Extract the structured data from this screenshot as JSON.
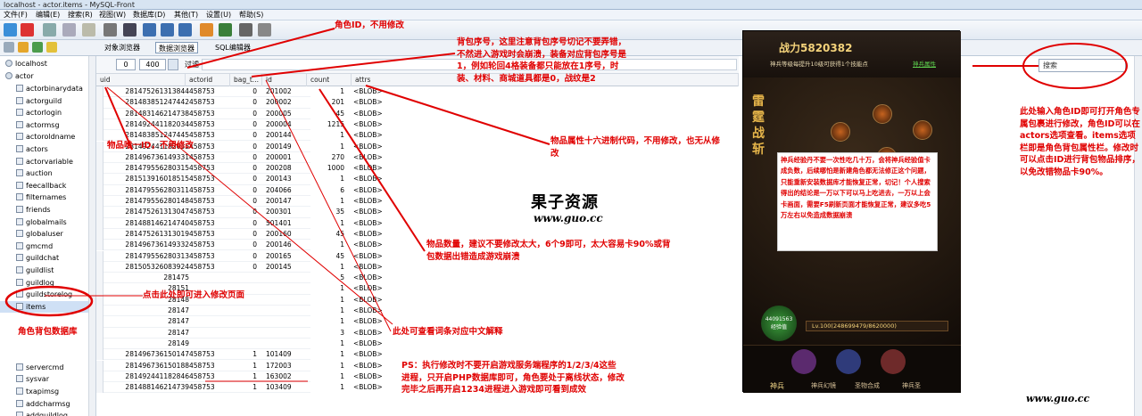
{
  "window": {
    "title": "localhost - actor.items - MySQL-Front"
  },
  "menu": [
    "文件(F)",
    "编辑(E)",
    "搜索(R)",
    "视图(W)",
    "数据库(D)",
    "其他(T)",
    "设置(U)",
    "帮助(S)"
  ],
  "tabs": {
    "object_browser": "对象浏览器",
    "data_browser": "数据浏览器",
    "sql_editor": "SQL编辑器"
  },
  "tree": {
    "host": "localhost",
    "db": "actor",
    "tables": [
      "actorbinarydata",
      "actorguild",
      "actorlogin",
      "actormsg",
      "actoroldname",
      "actors",
      "actorvariable",
      "auction",
      "feecallback",
      "filternames",
      "friends",
      "globalmails",
      "globaluser",
      "gmcmd",
      "guildchat",
      "guildlist",
      "guildlog",
      "guildstorelog",
      "items",
      "",
      "",
      "",
      "",
      "servercmd",
      "sysvar",
      "txapimsg",
      "addcharmsg",
      "addguildlog",
      "addguildmembe"
    ],
    "selected": "items"
  },
  "grid": {
    "offset": "0",
    "limit": "400",
    "filter_label": "过滤",
    "columns": [
      "uid",
      "actorid",
      "bag_t...",
      "id",
      "count",
      "attrs"
    ],
    "rows": [
      [
        "281475261313844",
        "458753",
        "0",
        "201002",
        "1",
        "<BLOB>"
      ],
      [
        "281483851247442",
        "458753",
        "0",
        "200002",
        "201",
        "<BLOB>"
      ],
      [
        "281483146214738",
        "458753",
        "0",
        "200005",
        "45",
        "<BLOB>"
      ],
      [
        "281492441182034",
        "458753",
        "0",
        "200004",
        "1215",
        "<BLOB>"
      ],
      [
        "281483851247445",
        "458753",
        "0",
        "200144",
        "1",
        "<BLOB>"
      ],
      [
        "281492441182035",
        "458753",
        "0",
        "200149",
        "1",
        "<BLOB>"
      ],
      [
        "281496736149331",
        "458753",
        "0",
        "200001",
        "270",
        "<BLOB>"
      ],
      [
        "281479556280315",
        "458753",
        "0",
        "200208",
        "1000",
        "<BLOB>"
      ],
      [
        "281513916018515",
        "458753",
        "0",
        "200143",
        "1",
        "<BLOB>"
      ],
      [
        "281479556280311",
        "458753",
        "0",
        "204066",
        "6",
        "<BLOB>"
      ],
      [
        "281479556280148",
        "458753",
        "0",
        "200147",
        "1",
        "<BLOB>"
      ],
      [
        "281475261313047",
        "458753",
        "0",
        "200301",
        "35",
        "<BLOB>"
      ],
      [
        "281488146214740",
        "458753",
        "0",
        "501401",
        "1",
        "<BLOB>"
      ],
      [
        "281475261313019",
        "458753",
        "0",
        "200160",
        "45",
        "<BLOB>"
      ],
      [
        "281496736149332",
        "458753",
        "0",
        "200146",
        "1",
        "<BLOB>"
      ],
      [
        "281479556280313",
        "458753",
        "0",
        "200165",
        "45",
        "<BLOB>"
      ],
      [
        "281505326083924",
        "458753",
        "0",
        "200145",
        "1",
        "<BLOB>"
      ],
      [
        "281475",
        "",
        "",
        "",
        "5",
        "<BLOB>"
      ],
      [
        "28151",
        "",
        "",
        "",
        "1",
        "<BLOB>"
      ],
      [
        "28148",
        "",
        "",
        "",
        "1",
        "<BLOB>"
      ],
      [
        "28147",
        "",
        "",
        "",
        "1",
        "<BLOB>"
      ],
      [
        "28147",
        "",
        "",
        "",
        "1",
        "<BLOB>"
      ],
      [
        "28147",
        "",
        "",
        "",
        "3",
        "<BLOB>"
      ],
      [
        "28149",
        "",
        "",
        "",
        "1",
        "<BLOB>"
      ],
      [
        "281496736150147",
        "458753",
        "1",
        "101409",
        "1",
        "<BLOB>"
      ],
      [
        "281496736150188",
        "458753",
        "1",
        "172003",
        "1",
        "<BLOB>"
      ],
      [
        "281492441182846",
        "458753",
        "1",
        "163002",
        "1",
        "<BLOB>"
      ],
      [
        "281488146214739",
        "458753",
        "1",
        "103409",
        "1",
        "<BLOB>"
      ]
    ]
  },
  "search": {
    "placeholder": "搜索"
  },
  "notes": {
    "actor_id": "角色ID，不用修改",
    "bag_seq": "背包序号，这里注意背包序号切记不要弄错，不然进入游戏时会崩溃，装备对应背包序号是1，例如轮回4格装备都只能放在1序号，时装、材料、商城道具都是0，战纹是2",
    "item_id": "物品唯一ID，不用修改",
    "attr": "物品属性十六进制代码，不用修改，也无从修改",
    "count": "物品数量，建议不要修改太大，6个9即可，太大容易卡90%或背包数据出错造成游戏崩溃",
    "click_edit": "点击此处即可进入修改页面",
    "lookup": "此处可查看词条对应中文解释",
    "items_db": "角色背包数据库",
    "ps": "PS：执行修改时不要开启游戏服务端程序的1/2/3/4这些进程，只开启PHP数据库即可，角色要处于离线状态，修改完毕之后再开启1234进程进入游戏即可看到成效",
    "right": "此处输入角色ID即可打开角色专属包裹进行修改，角色ID可以在actors选项查看。items选项栏即是角色背包属性栏。修改时可以点击ID进行背包物品排序，以免改错物品卡90%。"
  },
  "logo": {
    "name": "果子资源",
    "url": "www.guo.cc",
    "url2": "www.guo.cc"
  },
  "game": {
    "power": "战力5820382",
    "hint": "神兵等级每提升10级可获得1个技能点",
    "side_title": "雷霆战斩",
    "popup": "神兵经验丹不要一次性吃几十万，会将神兵经验值卡成负数，后续哪怕是新建角色都无法修正这个问题，只能重新安装数据库才能恢复正常，切记！个人搜索得出的结论是一万以下可以马上吃进去，一万以上会卡画面，需要F5刷新页面才能恢复正常，建议多吃5万左右以免造成数据崩溃",
    "exp_value": "44091563",
    "exp_label": "经验值",
    "level": "Lv.100(248699479/8620000)",
    "bottom_tabs": [
      "神兵",
      "神兵幻镜",
      "圣物合成",
      "神兵圣"
    ],
    "top_link": "神兵属性"
  },
  "colors": {
    "annotation": "#e00000",
    "selection": "#cfe0f5"
  }
}
